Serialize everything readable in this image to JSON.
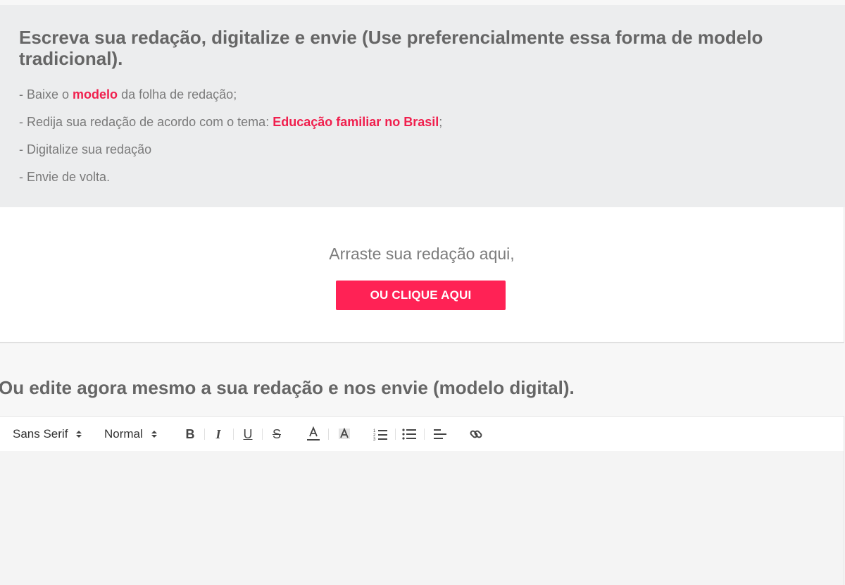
{
  "instructions": {
    "title": "Escreva sua redação, digitalize e envie (Use preferencialmente essa forma de modelo tradicional).",
    "step1_prefix": "- Baixe o ",
    "step1_link": "modelo",
    "step1_suffix": " da folha de redação;",
    "step2_prefix": "- Redija sua redação de acordo com o tema: ",
    "step2_link": "Educação familiar no Brasil",
    "step2_suffix": ";",
    "step3": "- Digitalize sua redação",
    "step4": "- Envie de volta."
  },
  "upload": {
    "drop_text": "Arraste sua redação aqui,",
    "button_label": "OU CLIQUE AQUI"
  },
  "digital": {
    "title": "Ou edite agora mesmo a sua redação e nos envie (modelo digital)."
  },
  "toolbar": {
    "font_value": "Sans Serif",
    "size_value": "Normal",
    "bold_label": "B",
    "italic_label": "I",
    "underline_label": "U",
    "strike_label": "S"
  },
  "colors": {
    "accent": "#ff2255",
    "link": "#f0204e",
    "panel_bg": "#ecedee",
    "text": "#6b6b6b"
  },
  "icons": [
    "bold-icon",
    "italic-icon",
    "underline-icon",
    "strike-icon",
    "text-color-icon",
    "background-color-icon",
    "ordered-list-icon",
    "bullet-list-icon",
    "align-left-icon",
    "link-icon"
  ]
}
